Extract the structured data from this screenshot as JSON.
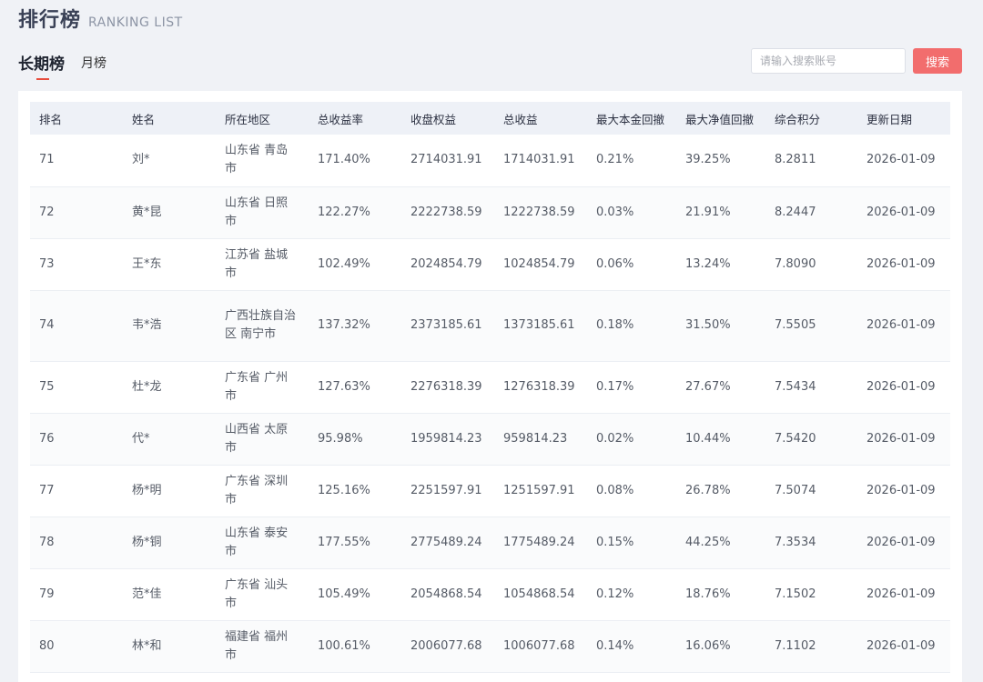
{
  "header": {
    "title": "排行榜",
    "subtitle": "RANKING LIST"
  },
  "tabs": [
    {
      "label": "长期榜",
      "active": true
    },
    {
      "label": "月榜",
      "active": false
    }
  ],
  "search": {
    "placeholder": "请输入搜索账号",
    "value": "",
    "button_label": "搜索"
  },
  "colors": {
    "accent": "#f26d6d",
    "header_bg": "#eef1f7",
    "page_bg": "#f0f2f6"
  },
  "table": {
    "columns": [
      "排名",
      "姓名",
      "所在地区",
      "总收益率",
      "收盘权益",
      "总收益",
      "最大本金回撤",
      "最大净值回撤",
      "综合积分",
      "更新日期"
    ],
    "rows": [
      {
        "rank": "71",
        "name": "刘*",
        "region": "山东省 青岛市",
        "total_return": "171.40%",
        "close_equity": "2714031.91",
        "total_profit": "1714031.91",
        "max_principal_dd": "0.21%",
        "max_nav_dd": "39.25%",
        "score": "8.2811",
        "update_date": "2026-01-09"
      },
      {
        "rank": "72",
        "name": "黄*昆",
        "region": "山东省 日照市",
        "total_return": "122.27%",
        "close_equity": "2222738.59",
        "total_profit": "1222738.59",
        "max_principal_dd": "0.03%",
        "max_nav_dd": "21.91%",
        "score": "8.2447",
        "update_date": "2026-01-09"
      },
      {
        "rank": "73",
        "name": "王*东",
        "region": "江苏省 盐城市",
        "total_return": "102.49%",
        "close_equity": "2024854.79",
        "total_profit": "1024854.79",
        "max_principal_dd": "0.06%",
        "max_nav_dd": "13.24%",
        "score": "7.8090",
        "update_date": "2026-01-09"
      },
      {
        "rank": "74",
        "name": "韦*浩",
        "region": "广西壮族自治区 南宁市",
        "total_return": "137.32%",
        "close_equity": "2373185.61",
        "total_profit": "1373185.61",
        "max_principal_dd": "0.18%",
        "max_nav_dd": "31.50%",
        "score": "7.5505",
        "update_date": "2026-01-09"
      },
      {
        "rank": "75",
        "name": "杜*龙",
        "region": "广东省 广州市",
        "total_return": "127.63%",
        "close_equity": "2276318.39",
        "total_profit": "1276318.39",
        "max_principal_dd": "0.17%",
        "max_nav_dd": "27.67%",
        "score": "7.5434",
        "update_date": "2026-01-09"
      },
      {
        "rank": "76",
        "name": "代*",
        "region": "山西省 太原市",
        "total_return": "95.98%",
        "close_equity": "1959814.23",
        "total_profit": "959814.23",
        "max_principal_dd": "0.02%",
        "max_nav_dd": "10.44%",
        "score": "7.5420",
        "update_date": "2026-01-09"
      },
      {
        "rank": "77",
        "name": "杨*明",
        "region": "广东省 深圳市",
        "total_return": "125.16%",
        "close_equity": "2251597.91",
        "total_profit": "1251597.91",
        "max_principal_dd": "0.08%",
        "max_nav_dd": "26.78%",
        "score": "7.5074",
        "update_date": "2026-01-09"
      },
      {
        "rank": "78",
        "name": "杨*铜",
        "region": "山东省 泰安市",
        "total_return": "177.55%",
        "close_equity": "2775489.24",
        "total_profit": "1775489.24",
        "max_principal_dd": "0.15%",
        "max_nav_dd": "44.25%",
        "score": "7.3534",
        "update_date": "2026-01-09"
      },
      {
        "rank": "79",
        "name": "范*佳",
        "region": "广东省 汕头市",
        "total_return": "105.49%",
        "close_equity": "2054868.54",
        "total_profit": "1054868.54",
        "max_principal_dd": "0.12%",
        "max_nav_dd": "18.76%",
        "score": "7.1502",
        "update_date": "2026-01-09"
      },
      {
        "rank": "80",
        "name": "林*和",
        "region": "福建省 福州市",
        "total_return": "100.61%",
        "close_equity": "2006077.68",
        "total_profit": "1006077.68",
        "max_principal_dd": "0.14%",
        "max_nav_dd": "16.06%",
        "score": "7.1102",
        "update_date": "2026-01-09"
      }
    ]
  }
}
